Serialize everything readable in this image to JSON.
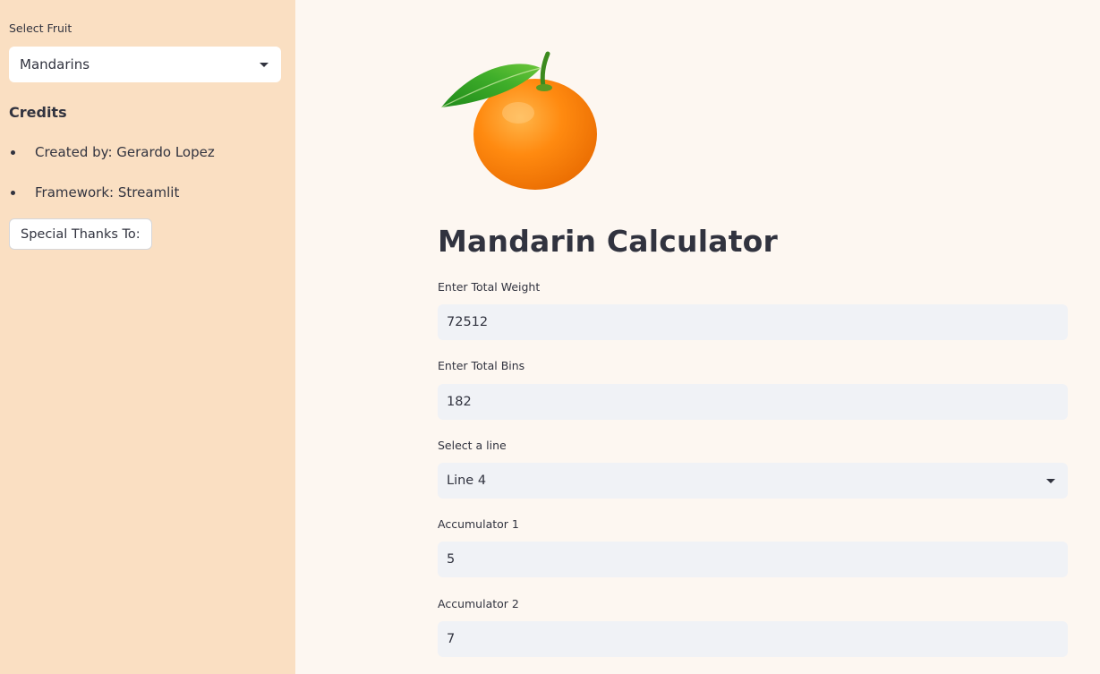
{
  "sidebar": {
    "select_label": "Select Fruit",
    "selected_fruit": "Mandarins",
    "credits_heading": "Credits",
    "credits_items": [
      "Created by: Gerardo Lopez",
      "Framework: Streamlit"
    ],
    "thanks_button": "Special Thanks To:"
  },
  "main": {
    "image_icon": "mandarin-image",
    "title": "Mandarin Calculator",
    "fields": {
      "total_weight": {
        "label": "Enter Total Weight",
        "value": "72512"
      },
      "total_bins": {
        "label": "Enter Total Bins",
        "value": "182"
      },
      "line": {
        "label": "Select a line",
        "value": "Line 4"
      },
      "accumulator1": {
        "label": "Accumulator 1",
        "value": "5"
      },
      "accumulator2": {
        "label": "Accumulator 2",
        "value": "7"
      }
    }
  },
  "colors": {
    "sidebar_bg": "#fadfc2",
    "main_bg": "#fdf7f1",
    "input_bg": "#f0f2f6",
    "text": "#31333f"
  }
}
